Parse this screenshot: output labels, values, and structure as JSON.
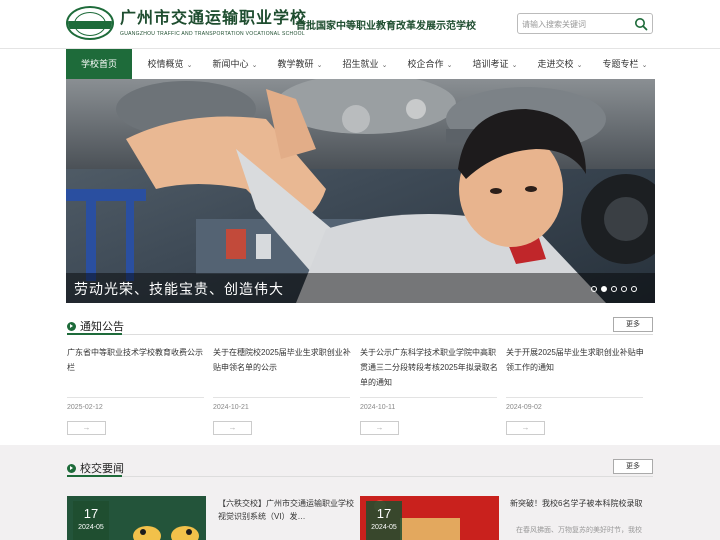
{
  "header": {
    "school_name": "广州市交通运输职业学校",
    "school_name_en": "GUANGZHOU TRAFFIC AND TRANSPORTATION VOCATIONAL SCHOOL",
    "slogan": "首批国家中等职业教育改革发展示范学校",
    "search_placeholder": "请输入搜索关键词",
    "brand_color": "#1e6b3a"
  },
  "nav": {
    "items": [
      {
        "label": "学校首页",
        "active": true
      },
      {
        "label": "校情概览"
      },
      {
        "label": "新闻中心"
      },
      {
        "label": "教学教研"
      },
      {
        "label": "招生就业"
      },
      {
        "label": "校企合作"
      },
      {
        "label": "培训考证"
      },
      {
        "label": "走进交校"
      },
      {
        "label": "专题专栏"
      }
    ]
  },
  "banner": {
    "caption": "劳动光荣、技能宝贵、创造伟大",
    "slide_count": 5,
    "active_slide": 2
  },
  "notices": {
    "title": "通知公告",
    "more": "更多",
    "arrow": "→",
    "items": [
      {
        "title": "广东省中等职业技术学校教育收费公示栏",
        "date": "2025-02-12"
      },
      {
        "title": "关于在穗院校2025届毕业生求职创业补贴申领名单的公示",
        "date": "2024-10-21"
      },
      {
        "title": "关于公示广东科学技术职业学院中高职贯通三二分段转段考核2025年拟录取名单的通知",
        "date": "2024-10-11"
      },
      {
        "title": "关于开展2025届毕业生求职创业补贴申领工作的通知",
        "date": "2024-09-02"
      }
    ]
  },
  "news": {
    "title": "校交要闻",
    "more": "更多",
    "items": [
      {
        "day": "17",
        "ym": "2024-05",
        "title": "【六秩交校】广州市交通运输职业学校视觉识别系统（VI）发…",
        "desc": ""
      },
      {
        "day": "17",
        "ym": "2024-05",
        "title": "新突破！我校6名学子被本科院校录取",
        "desc": "在春风拂面、万物复苏的美好时节，我校"
      }
    ]
  }
}
